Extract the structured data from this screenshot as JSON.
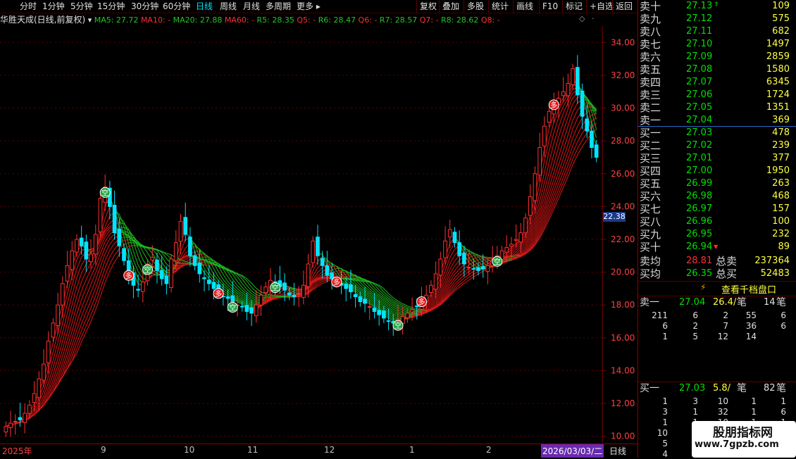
{
  "toolbar": {
    "periods": [
      "分时",
      "1分钟",
      "5分钟",
      "15分钟",
      "30分钟",
      "60分钟",
      "日线",
      "周线",
      "月线",
      "多周期",
      "更多"
    ],
    "active": "日线",
    "right": [
      "复权",
      "叠加",
      "多股",
      "统计",
      "画线",
      "F10",
      "标记",
      "+自选",
      "返回"
    ]
  },
  "chart": {
    "title": "华胜天成(日线,前复权)",
    "ma_items": [
      {
        "label": "MA5: 27.72",
        "color": "#22c522"
      },
      {
        "label": "MA10: -",
        "color": "#ff3030"
      },
      {
        "label": "MA20: 27.88",
        "color": "#22c522"
      },
      {
        "label": "MA60: -",
        "color": "#ff3030"
      },
      {
        "label": "R5: 28.35",
        "color": "#22c522"
      },
      {
        "label": "Q5: -",
        "color": "#ff3030"
      },
      {
        "label": "R6: 28.47",
        "color": "#22c522"
      },
      {
        "label": "Q6: -",
        "color": "#ff3030"
      },
      {
        "label": "R7: 28.57",
        "color": "#22c522"
      },
      {
        "label": "Q7: -",
        "color": "#ff3030"
      },
      {
        "label": "R8: 28.62",
        "color": "#22c522"
      },
      {
        "label": "Q8: -",
        "color": "#ff3030"
      }
    ],
    "price_ticks": [
      "34.00",
      "32.00",
      "30.00",
      "28.00",
      "26.00",
      "24.00",
      "22.00",
      "20.00",
      "18.00",
      "16.00",
      "14.00",
      "12.00",
      "10.00"
    ],
    "current_price_tag": "22.38",
    "date_labels": [
      "2025年",
      "9",
      "10",
      "11",
      "12",
      "1",
      "2"
    ],
    "cursor_date": "2026/03/03/二",
    "period_tag": "日线",
    "signal_buy": "多",
    "signal_empty": "空",
    "chart_data": {
      "type": "candlestick",
      "ylim": [
        9.6,
        35.0
      ],
      "closes": [
        10.6,
        10.8,
        10.9,
        11.0,
        11.4,
        11.9,
        12.6,
        13.5,
        14.4,
        15.8,
        16.9,
        18.0,
        19.3,
        20.4,
        21.3,
        22.0,
        21.6,
        20.8,
        21.1,
        22.3,
        24.5,
        25.2,
        24.0,
        22.4,
        21.6,
        20.7,
        19.8,
        19.2,
        18.9,
        19.4,
        20.5,
        20.9,
        20.1,
        19.6,
        19.3,
        20.8,
        21.8,
        23.1,
        22.3,
        21.0,
        20.4,
        19.9,
        19.6,
        19.3,
        19.0,
        18.7,
        18.5,
        18.4,
        18.2,
        18.0,
        17.9,
        17.6,
        17.5,
        18.0,
        18.6,
        19.1,
        19.5,
        19.4,
        19.1,
        18.9,
        18.6,
        18.5,
        18.7,
        19.2,
        20.5,
        21.9,
        21.0,
        20.4,
        19.8,
        19.6,
        19.4,
        19.2,
        19.0,
        18.8,
        18.5,
        18.2,
        18.1,
        17.9,
        17.6,
        17.4,
        17.2,
        17.0,
        16.9,
        17.1,
        17.3,
        17.5,
        17.7,
        17.9,
        18.2,
        18.6,
        19.2,
        19.9,
        20.8,
        21.9,
        22.6,
        21.8,
        21.0,
        20.5,
        20.3,
        20.2,
        20.1,
        20.2,
        20.4,
        20.7,
        21.0,
        21.3,
        21.5,
        21.7,
        22.0,
        22.4,
        23.3,
        24.6,
        26.0,
        27.6,
        28.9,
        29.8,
        30.2,
        30.6,
        31.0,
        31.5,
        32.4,
        30.8,
        29.5,
        28.6,
        27.6,
        27.0
      ]
    }
  },
  "order_book": {
    "sell": [
      {
        "label": "卖十",
        "price": "27.13",
        "vol": "109"
      },
      {
        "label": "卖九",
        "price": "27.12",
        "vol": "575"
      },
      {
        "label": "卖八",
        "price": "27.11",
        "vol": "682"
      },
      {
        "label": "卖七",
        "price": "27.10",
        "vol": "1497"
      },
      {
        "label": "卖六",
        "price": "27.09",
        "vol": "2859"
      },
      {
        "label": "卖五",
        "price": "27.08",
        "vol": "1580"
      },
      {
        "label": "卖四",
        "price": "27.07",
        "vol": "6345"
      },
      {
        "label": "卖三",
        "price": "27.06",
        "vol": "1724"
      },
      {
        "label": "卖二",
        "price": "27.05",
        "vol": "1351"
      },
      {
        "label": "卖一",
        "price": "27.04",
        "vol": "369"
      }
    ],
    "buy": [
      {
        "label": "买一",
        "price": "27.03",
        "vol": "478"
      },
      {
        "label": "买二",
        "price": "27.02",
        "vol": "239"
      },
      {
        "label": "买三",
        "price": "27.01",
        "vol": "377"
      },
      {
        "label": "买四",
        "price": "27.00",
        "vol": "1950"
      },
      {
        "label": "买五",
        "price": "26.99",
        "vol": "263"
      },
      {
        "label": "买六",
        "price": "26.98",
        "vol": "468"
      },
      {
        "label": "买七",
        "price": "26.97",
        "vol": "157"
      },
      {
        "label": "买八",
        "price": "26.96",
        "vol": "100"
      },
      {
        "label": "买九",
        "price": "26.95",
        "vol": "232"
      },
      {
        "label": "买十",
        "price": "26.94",
        "vol": "89"
      }
    ],
    "avg_sell_label": "卖均",
    "avg_sell": "28.81",
    "total_sell_label": "总卖",
    "total_sell": "237364",
    "avg_buy_label": "买均",
    "avg_buy": "26.35",
    "total_buy_label": "总买",
    "total_buy": "52483",
    "view_thousand": "查看千档盘口",
    "sell1_label": "卖一",
    "sell1_price": "27.04",
    "sell1_avg": "26.4/",
    "sell1_unit": "笔",
    "sell1_count": "14",
    "sell1_count_unit": "笔",
    "sell1_queue": [
      [
        "211",
        "6",
        "2",
        "55",
        "6"
      ],
      [
        "6",
        "2",
        "7",
        "36",
        "6"
      ],
      [
        "1",
        "5",
        "12",
        "14",
        ""
      ]
    ],
    "buy1_label": "买一",
    "buy1_price": "27.03",
    "buy1_avg": "5.8/",
    "buy1_unit": "笔",
    "buy1_count": "82",
    "buy1_count_unit": "笔",
    "buy1_queue": [
      [
        "1",
        "3",
        "10",
        "1",
        "1"
      ],
      [
        "3",
        "1",
        "32",
        "1",
        "6"
      ],
      [
        "1",
        "1",
        "10",
        "1",
        "1"
      ],
      [
        "10",
        "",
        "",
        "",
        ""
      ],
      [
        "5",
        "",
        "",
        "",
        ""
      ],
      [
        "4",
        "",
        "",
        "",
        ""
      ]
    ]
  },
  "watermark": {
    "title": "股朋指标网",
    "url": "www.7gpzb.com"
  },
  "colors": {
    "up": "#ff3030",
    "down": "#00e5ff",
    "ma_green": "#22c522",
    "grid": "#5a0000",
    "accent": "#ffff40"
  }
}
